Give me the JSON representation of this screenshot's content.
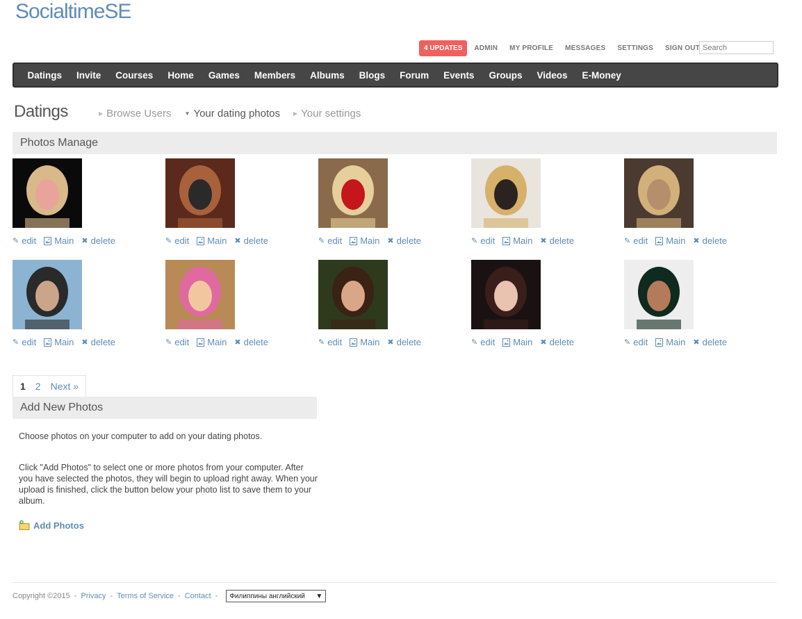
{
  "site": {
    "logo": "SocialtimeSE"
  },
  "top_links": {
    "updates": "4 UPDATES",
    "items": [
      "ADMIN",
      "MY PROFILE",
      "MESSAGES",
      "SETTINGS",
      "SIGN OUT"
    ],
    "search_placeholder": "Search"
  },
  "main_nav": [
    "Datings",
    "Invite",
    "Courses",
    "Home",
    "Games",
    "Members",
    "Albums",
    "Blogs",
    "Forum",
    "Events",
    "Groups",
    "Videos",
    "E-Money"
  ],
  "page": {
    "title": "Datings",
    "tabs": [
      {
        "label": "Browse Users",
        "active": false
      },
      {
        "label": "Your dating photos",
        "active": true
      },
      {
        "label": "Your settings",
        "active": false
      }
    ]
  },
  "photos_section": {
    "title": "Photos Manage",
    "action_labels": {
      "edit": "edit",
      "main": "Main",
      "delete": "delete"
    },
    "photos": [
      {
        "colors": [
          "#0a0a0a",
          "#d9b88a",
          "#e9a39a"
        ]
      },
      {
        "colors": [
          "#5b2a1c",
          "#a8613b",
          "#2a2a2a"
        ]
      },
      {
        "colors": [
          "#8a6a4a",
          "#e6cf9a",
          "#c4161c"
        ]
      },
      {
        "colors": [
          "#e9e4de",
          "#d7b06a",
          "#2b2320"
        ]
      },
      {
        "colors": [
          "#4b3a30",
          "#d2b07a",
          "#b58f6c"
        ]
      },
      {
        "colors": [
          "#8cb4d2",
          "#2a2a2a",
          "#caa58a"
        ]
      },
      {
        "colors": [
          "#b88a55",
          "#e06aa0",
          "#f2c7a0"
        ]
      },
      {
        "colors": [
          "#2d3a1c",
          "#3a2214",
          "#d9a687"
        ]
      },
      {
        "colors": [
          "#1a1212",
          "#3a1e1a",
          "#e9c2b0"
        ]
      },
      {
        "colors": [
          "#eeeeee",
          "#0f2a1e",
          "#b57a5a"
        ]
      }
    ]
  },
  "pagination": {
    "pages": [
      "1",
      "2"
    ],
    "current": "1",
    "next": "Next »"
  },
  "add_section": {
    "title": "Add New Photos",
    "intro": "Choose photos on your computer to add on your dating photos.",
    "instructions": "Click \"Add Photos\" to select one or more photos from your computer. After you have selected the photos, they will begin to upload right away. When your upload is finished, click the button below your photo list to save them to your album.",
    "button": "Add Photos"
  },
  "footer": {
    "copyright": "Copyright ©2015",
    "links": [
      "Privacy",
      "Terms of Service",
      "Contact"
    ],
    "language": "Филиппины английский"
  },
  "colors": {
    "accent": "#5f8cb4",
    "nav_bg": "#464646",
    "badge": "#f0605e"
  }
}
